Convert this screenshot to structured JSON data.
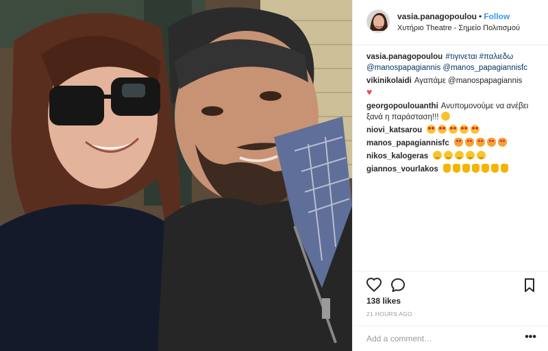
{
  "post": {
    "username": "vasia.panagopoulou",
    "separator": "•",
    "follow_label": "Follow",
    "location": "Χυτήριο Theatre - Σημείο Πολιτισμού"
  },
  "caption": {
    "user": "vasia.panagopoulou",
    "text": "#τιγινεται #παλιεδω @manospapagiannis @manos_papagiannisfc"
  },
  "comments": [
    {
      "user": "vikinikolaidi",
      "text": "Αγαπάμε @manospapagiannis",
      "emoji": [
        "heart"
      ]
    },
    {
      "user": "georgopoulouanthi",
      "text": "Ανυπομονούμε να ανέβει ξανά η παράσταση!!!",
      "emoji": [
        "wink"
      ]
    },
    {
      "user": "niovi_katsarou",
      "text": "",
      "emoji": [
        "love",
        "love",
        "love",
        "love",
        "love"
      ]
    },
    {
      "user": "manos_papagiannisfc",
      "text": "",
      "emoji": [
        "cat",
        "cat",
        "cat",
        "cat",
        "cat"
      ]
    },
    {
      "user": "nikos_kalogeras",
      "text": "",
      "emoji": [
        "blush",
        "blush",
        "blush",
        "blush",
        "blush"
      ]
    },
    {
      "user": "giannos_vourlakos",
      "text": "",
      "emoji": [
        "thumb",
        "thumb",
        "thumb",
        "thumb",
        "thumb",
        "thumb",
        "thumb"
      ]
    }
  ],
  "stats": {
    "likes": "138 likes",
    "time": "21 HOURS AGO"
  },
  "add_comment": {
    "placeholder": "Add a comment…",
    "more_label": "•••"
  },
  "icons": {
    "like": "heart-outline-icon",
    "comment": "speech-bubble-icon",
    "save": "bookmark-icon",
    "more": "ellipsis-icon"
  },
  "colors": {
    "link": "#3897f0",
    "mention": "#003569",
    "muted": "#999999",
    "heart": "#ed4956"
  }
}
